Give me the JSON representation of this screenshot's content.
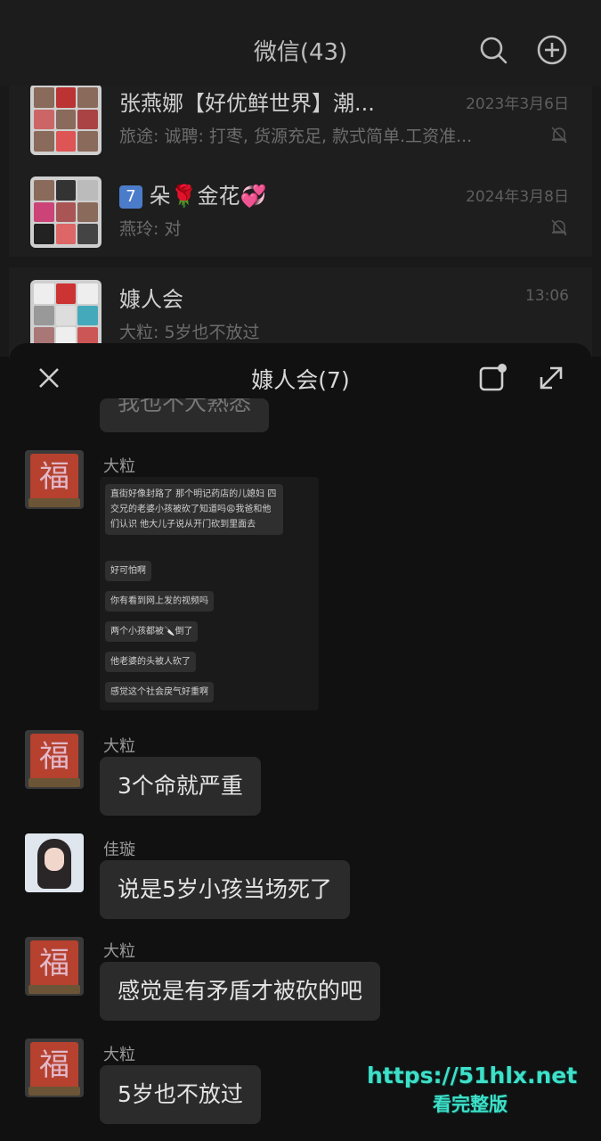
{
  "top_bar": {
    "title": "微信(43)"
  },
  "chat_list": [
    {
      "name": "张燕娜【好优鲜世界】潮...",
      "preview": "旅途: 诚聘: 打枣, 货源充足, 款式简单.工资准...",
      "time": "2023年3月6日",
      "muted": true
    },
    {
      "badge": "7",
      "name": "朵🌹金花💞",
      "preview": "燕玲: 对",
      "time": "2024年3月8日",
      "muted": true
    },
    {
      "name": "嫝人会",
      "preview": "大粒: 5岁也不放过",
      "time": "13:06",
      "muted": false
    }
  ],
  "panel": {
    "title": "嫝人会(7)",
    "partial_top_message": "我也不大熟悉",
    "messages": [
      {
        "sender": "大粒",
        "avatar": "fu-avatar",
        "screenshot": [
          "直街好像封路了 那个明记药店的儿媳妇 四交兄的老婆小孩被砍了知道吗😩我爸和他们认识 他大儿子说从开门砍到里面去",
          "好可怕啊",
          "你有看到网上发的视频吗",
          "两个小孩都被🔪倒了",
          "他老婆的头被人砍了",
          "感觉这个社会戾气好重啊"
        ]
      },
      {
        "sender": "大粒",
        "avatar": "fu-avatar",
        "text": "3个命就严重"
      },
      {
        "sender": "佳璇",
        "avatar": "girl-avatar",
        "text": "说是5岁小孩当场死了"
      },
      {
        "sender": "大粒",
        "avatar": "fu-avatar",
        "text": "感觉是有矛盾才被砍的吧"
      },
      {
        "sender": "大粒",
        "avatar": "fu-avatar",
        "text": "5岁也不放过"
      }
    ]
  },
  "avatar_glyph": "福",
  "watermark": {
    "url": "https://51hlx.net",
    "caption": "看完整版"
  }
}
